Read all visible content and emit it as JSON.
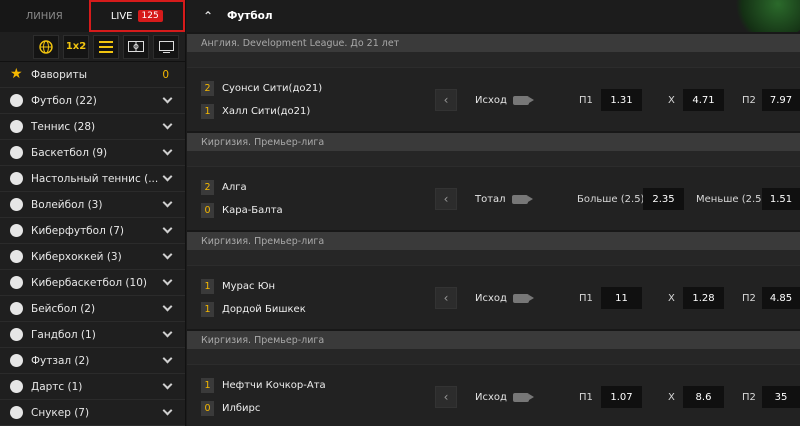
{
  "tabs": {
    "line": "ЛИНИЯ",
    "live": "LIVE",
    "live_count": "125"
  },
  "view_buttons": [
    {
      "icon": "globe-icon",
      "label": ""
    },
    {
      "icon": "1x2-icon",
      "label": "1x2"
    },
    {
      "icon": "list-icon",
      "label": ""
    },
    {
      "icon": "field-icon",
      "label": ""
    },
    {
      "icon": "monitor-icon",
      "label": ""
    }
  ],
  "sidebar": {
    "favorites": {
      "label": "Фавориты",
      "count": "0"
    },
    "items": [
      {
        "label": "Футбол (22)",
        "icon": "football-icon"
      },
      {
        "label": "Теннис (28)",
        "icon": "tennis-icon"
      },
      {
        "label": "Баскетбол (9)",
        "icon": "basketball-icon"
      },
      {
        "label": "Настольный теннис (...",
        "icon": "table-tennis-icon"
      },
      {
        "label": "Волейбол (3)",
        "icon": "volleyball-icon"
      },
      {
        "label": "Киберфутбол (7)",
        "icon": "cyber-football-icon"
      },
      {
        "label": "Киберхоккей (3)",
        "icon": "cyber-hockey-icon"
      },
      {
        "label": "Кибербаскетбол (10)",
        "icon": "cyber-basketball-icon"
      },
      {
        "label": "Бейсбол (2)",
        "icon": "baseball-icon"
      },
      {
        "label": "Гандбол (1)",
        "icon": "handball-icon"
      },
      {
        "label": "Футзал (2)",
        "icon": "futsal-icon"
      },
      {
        "label": "Дартс (1)",
        "icon": "darts-icon"
      },
      {
        "label": "Снукер (7)",
        "icon": "snooker-icon"
      }
    ]
  },
  "header": {
    "title": "Футбол"
  },
  "events": [
    {
      "league": "Англия. Development League. До 21 лет",
      "teams": [
        {
          "score": "2",
          "name": "Суонси Сити(до21)"
        },
        {
          "score": "1",
          "name": "Халл Сити(до21)"
        }
      ],
      "market": "Исход",
      "odds": [
        {
          "label": "П1",
          "value": "1.31"
        },
        {
          "label": "Х",
          "value": "4.71"
        },
        {
          "label": "П2",
          "value": "7.97"
        }
      ]
    },
    {
      "league": "Киргизия. Премьер-лига",
      "teams": [
        {
          "score": "2",
          "name": "Алга"
        },
        {
          "score": "0",
          "name": "Кара-Балта"
        }
      ],
      "market": "Тотал",
      "odds": [
        {
          "label": "Больше (2.5)",
          "value": "2.35"
        },
        {
          "label": "Меньше (2.5)",
          "value": "1.51"
        }
      ]
    },
    {
      "league": "Киргизия. Премьер-лига",
      "teams": [
        {
          "score": "1",
          "name": "Мурас Юн"
        },
        {
          "score": "1",
          "name": "Дордой Бишкек"
        }
      ],
      "market": "Исход",
      "odds": [
        {
          "label": "П1",
          "value": "11"
        },
        {
          "label": "Х",
          "value": "1.28"
        },
        {
          "label": "П2",
          "value": "4.85"
        }
      ]
    },
    {
      "league": "Киргизия. Премьер-лига",
      "teams": [
        {
          "score": "1",
          "name": "Нефтчи Кочкор-Ата"
        },
        {
          "score": "0",
          "name": "Илбирс"
        }
      ],
      "market": "Исход",
      "odds": [
        {
          "label": "П1",
          "value": "1.07"
        },
        {
          "label": "Х",
          "value": "8.6"
        },
        {
          "label": "П2",
          "value": "35"
        }
      ]
    }
  ]
}
